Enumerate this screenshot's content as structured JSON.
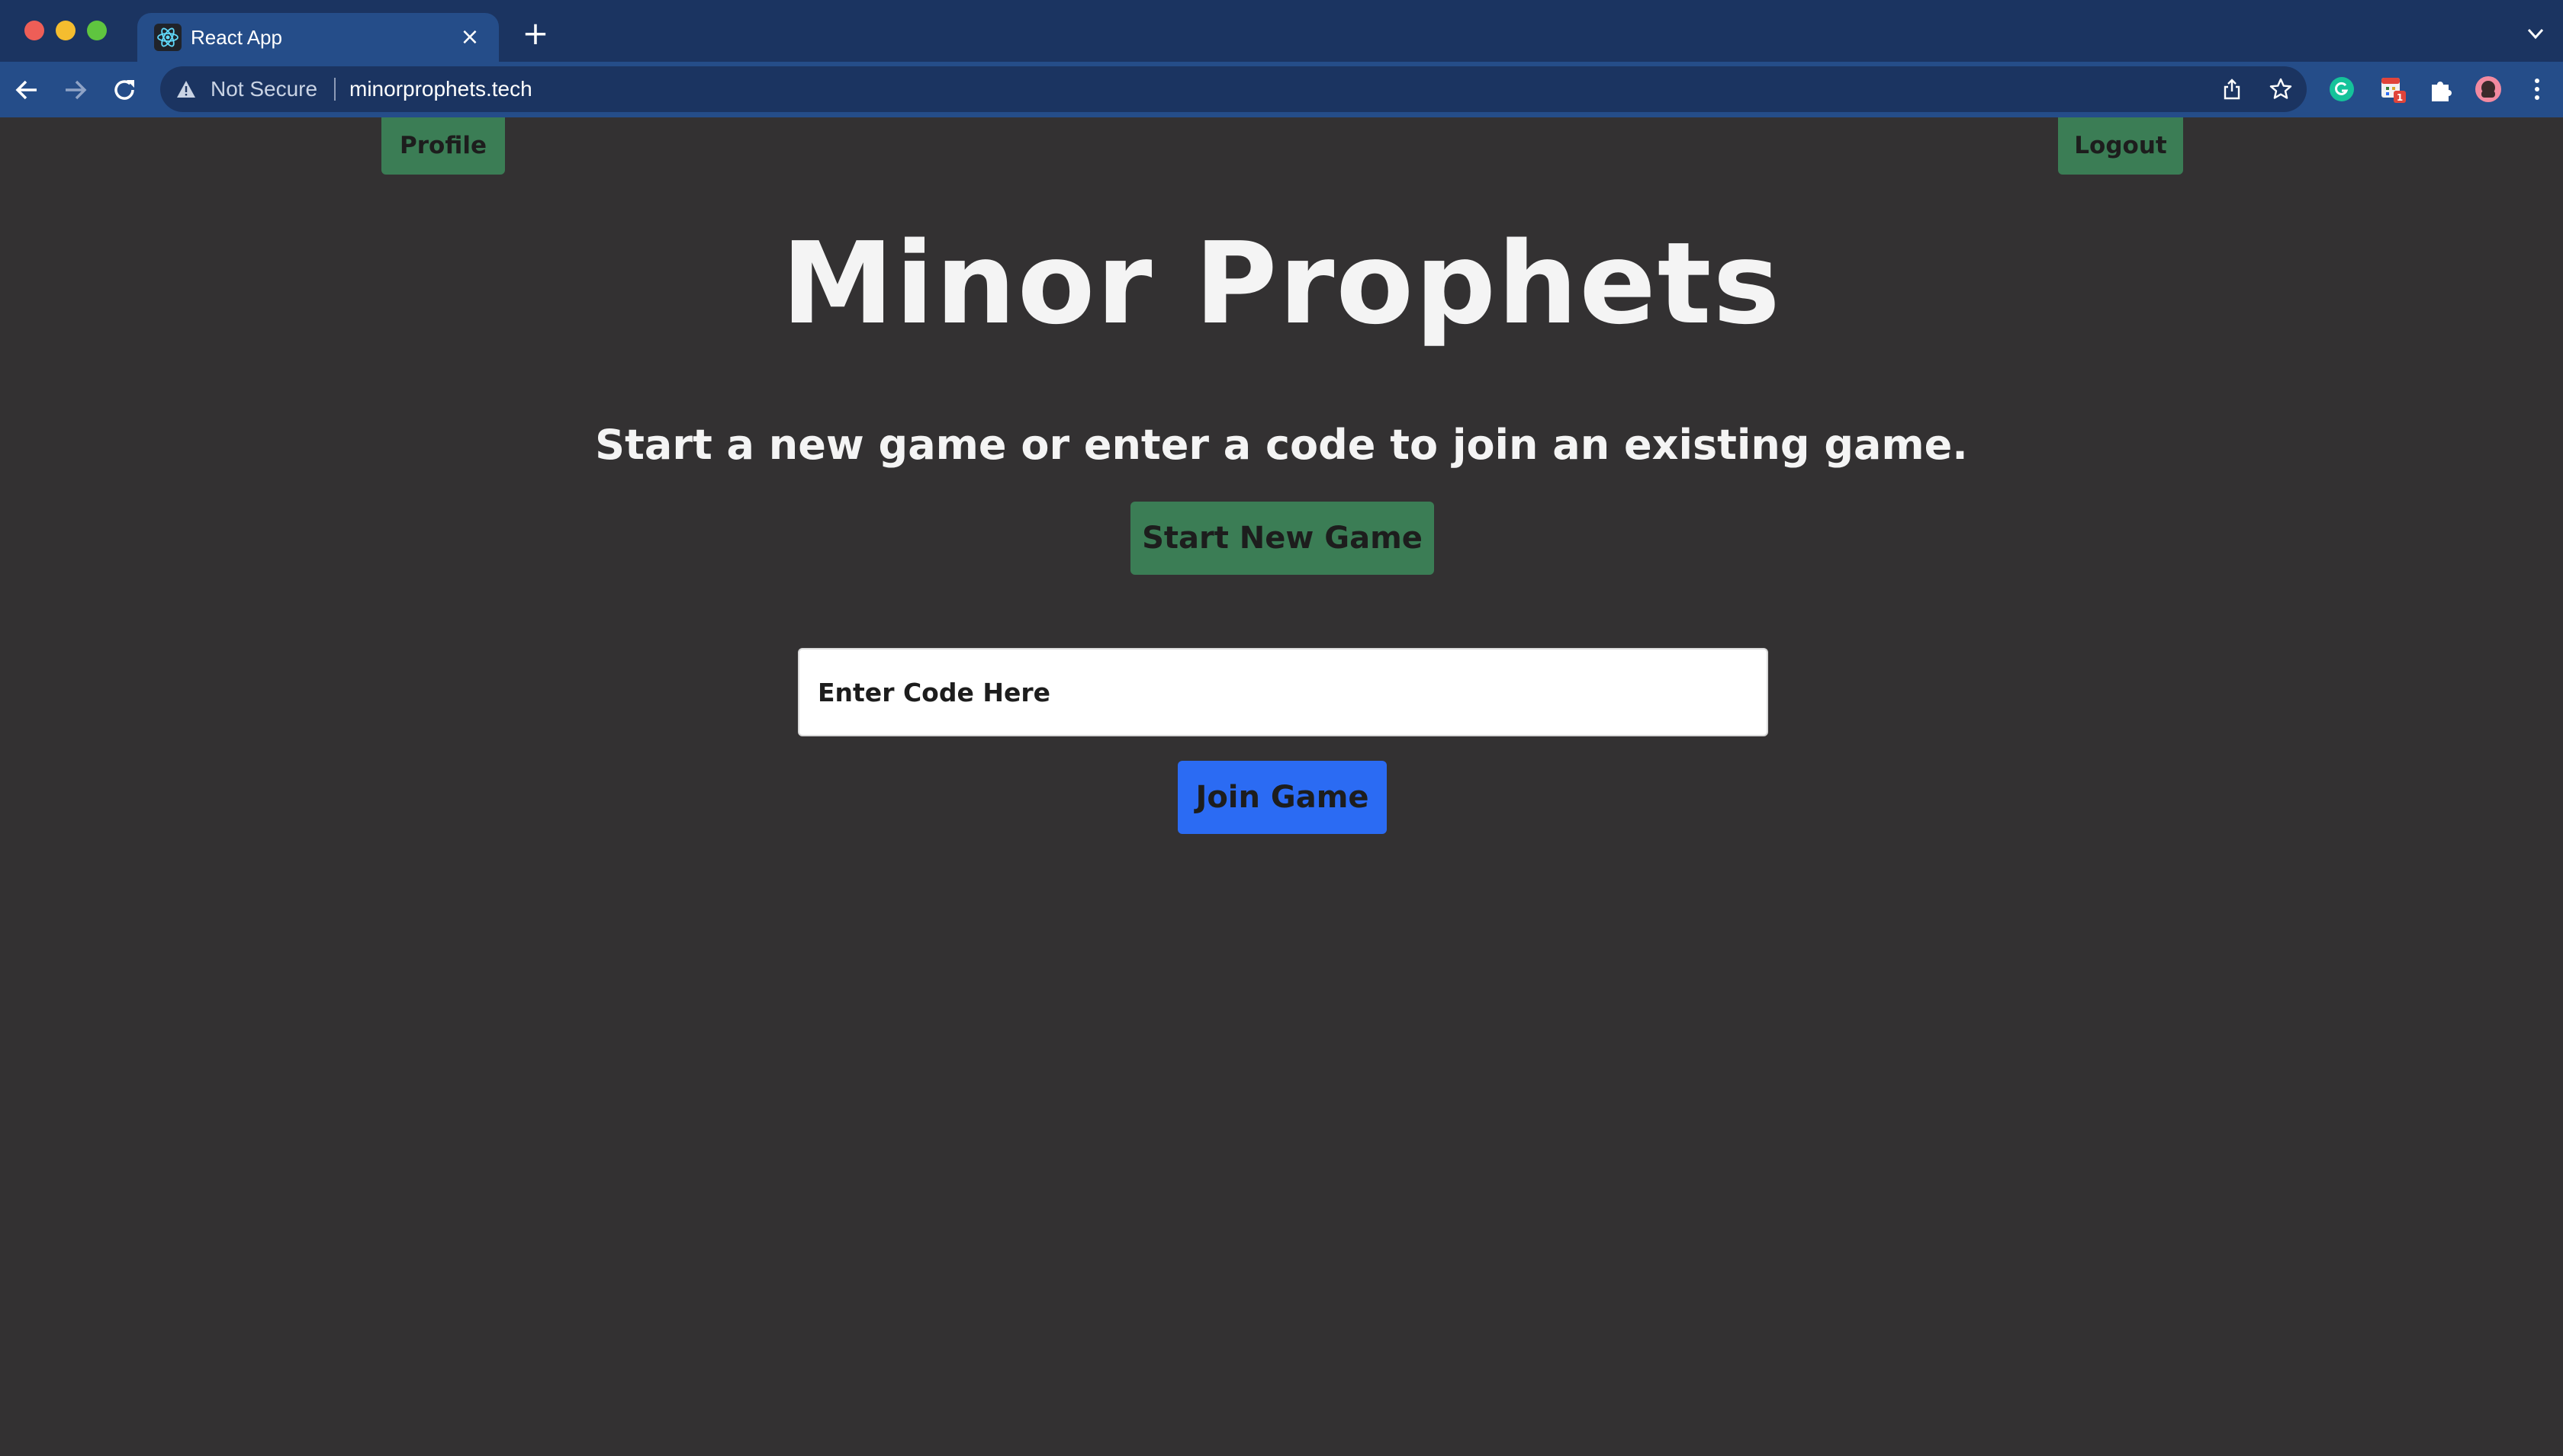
{
  "browser": {
    "tab_title": "React App",
    "tab_close_glyph": "×",
    "new_tab_glyph": "+",
    "security_label": "Not Secure",
    "url": "minorprophets.tech",
    "icons": [
      "react-favicon-icon",
      "back-arrow-icon",
      "forward-arrow-icon",
      "reload-icon",
      "warning-icon",
      "share-icon",
      "star-icon",
      "grammarly-icon",
      "calendar-extension-icon",
      "extensions-puzzle-icon",
      "profile-avatar-icon",
      "kebab-menu-icon",
      "tab-search-chevron-icon"
    ],
    "extension_badge": "1",
    "colors": {
      "tabstrip": "#1b3461",
      "toolbar": "#254d89"
    }
  },
  "page": {
    "profile_label": "Profile",
    "logout_label": "Logout",
    "title": "Minor Prophets",
    "subtitle": "Start a new game or enter a code to join an existing game.",
    "start_label": "Start New Game",
    "code_placeholder": "Enter Code Here",
    "code_value": "",
    "join_label": "Join Game",
    "colors": {
      "background": "#333132",
      "green_button": "#3b7d55",
      "blue_button": "#2b6bf3"
    }
  }
}
